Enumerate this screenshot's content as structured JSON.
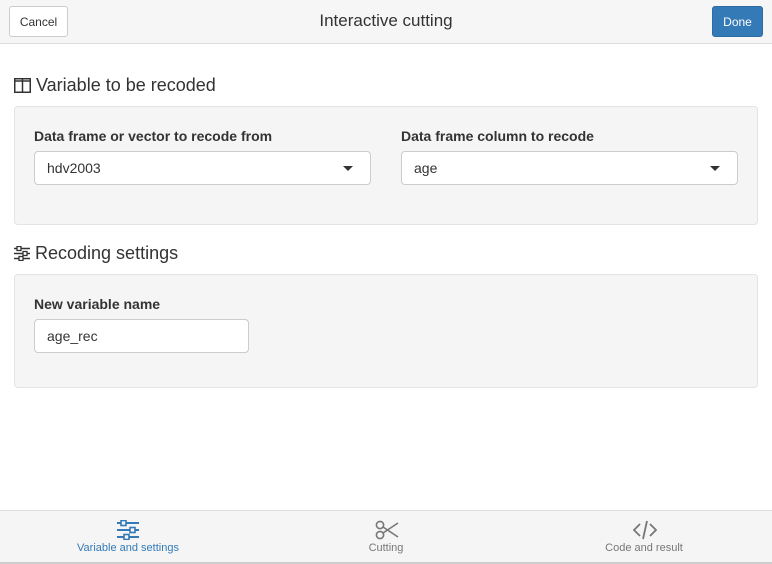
{
  "header": {
    "title": "Interactive cutting",
    "cancel_label": "Cancel",
    "done_label": "Done"
  },
  "sections": {
    "variable": {
      "title": "Variable to be recoded",
      "icon": "columns-icon",
      "dataframe_label": "Data frame or vector to recode from",
      "dataframe_value": "hdv2003",
      "column_label": "Data frame column to recode",
      "column_value": "age"
    },
    "settings": {
      "title": "Recoding settings",
      "icon": "sliders-icon",
      "newvar_label": "New variable name",
      "newvar_value": "age_rec"
    }
  },
  "tabs": [
    {
      "label": "Variable and settings",
      "icon": "sliders-icon",
      "active": true
    },
    {
      "label": "Cutting",
      "icon": "scissors-icon",
      "active": false
    },
    {
      "label": "Code and result",
      "icon": "code-icon",
      "active": false
    }
  ],
  "colors": {
    "accent": "#337ab7",
    "panel_bg": "#f5f5f5",
    "inactive_tab": "#777777"
  }
}
